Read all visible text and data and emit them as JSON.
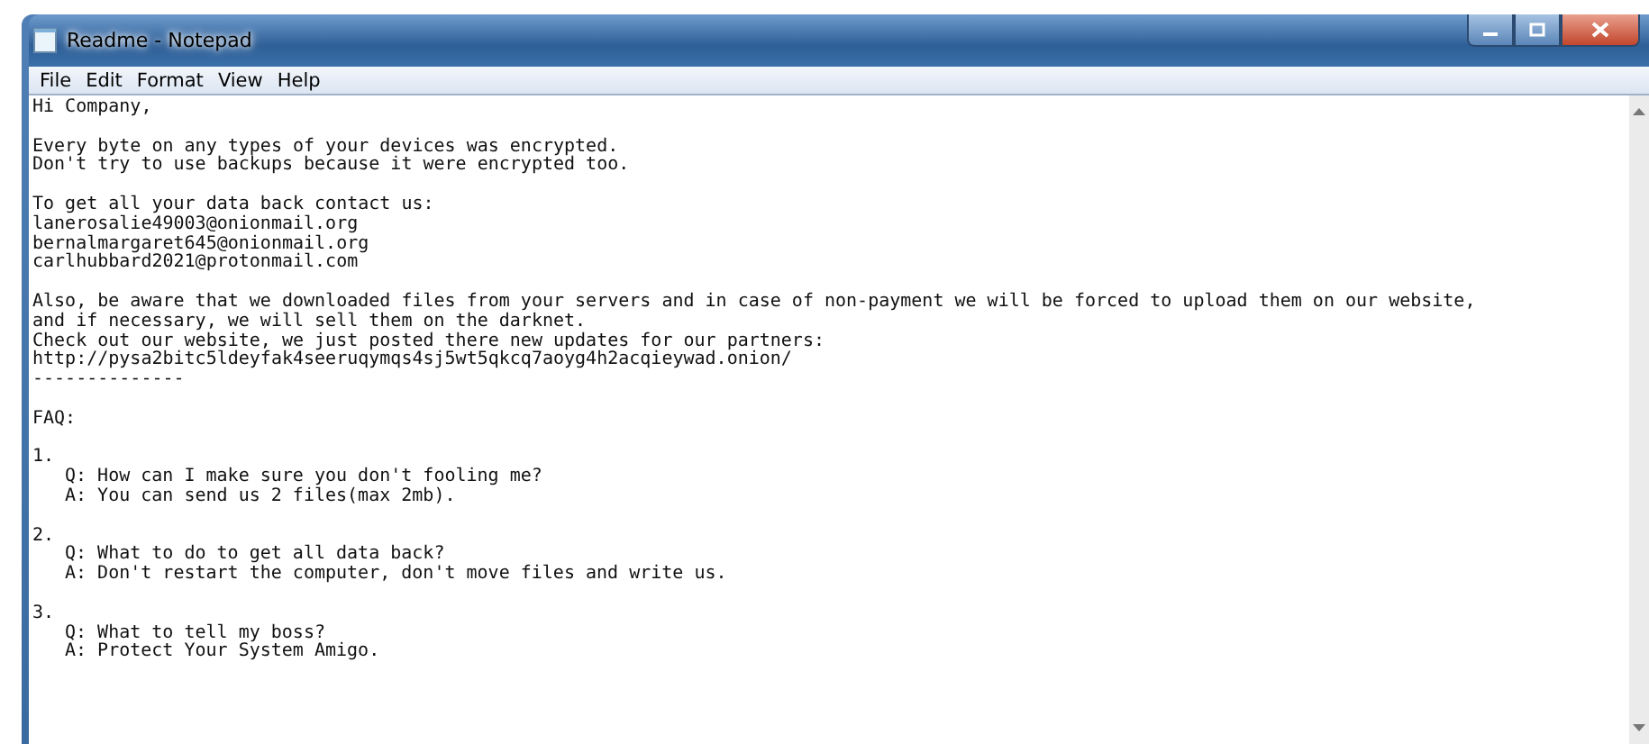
{
  "window": {
    "title": "Readme - Notepad"
  },
  "menu": [
    "File",
    "Edit",
    "Format",
    "View",
    "Help"
  ],
  "document": {
    "paragraphs": [
      [
        "Hi Company,"
      ],
      [
        "Every byte on any types of your devices was encrypted.",
        "Don't try to use backups because it were encrypted too."
      ],
      [
        "To get all your data back contact us:",
        "lanerosalie49003@onionmail.org",
        "bernalmargaret645@onionmail.org",
        "carlhubbard2021@protonmail.com"
      ],
      [
        "Also, be aware that we downloaded files from your servers and in case of non-payment we will be forced to upload them on our website,",
        "and if necessary, we will sell them on the darknet.",
        "Check out our website, we just posted there new updates for our partners:",
        "http://pysa2bitc5ldeyfak4seeruqymqs4sj5wt5qkcq7aoyg4h2acqieywad.onion/",
        "--------------"
      ],
      [
        "FAQ:"
      ]
    ],
    "faq": [
      {
        "number": "1.",
        "question": "Q: How can I make sure you don't fooling me?",
        "answer": "A: You can send us 2 files(max 2mb)."
      },
      {
        "number": "2.",
        "question": "Q: What to do to get all data back?",
        "answer": "A: Don't restart the computer, don't move files and write us."
      },
      {
        "number": "3.",
        "question": "Q: What to tell my boss?",
        "answer": "A: Protect Your System Amigo."
      }
    ]
  }
}
